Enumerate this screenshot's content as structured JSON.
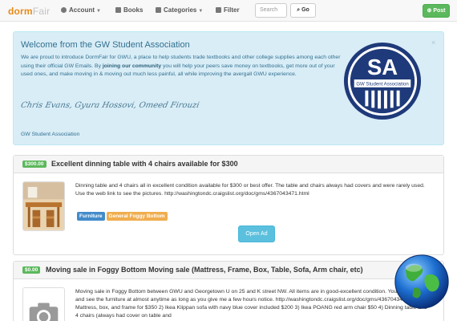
{
  "navbar": {
    "brand_main": "dorm",
    "brand_light": "Fair",
    "account_label": "Account",
    "books_label": "Books",
    "categories_label": "Categories",
    "filter_label": "Filter",
    "search_placeholder": "Search",
    "go_label": "Go",
    "post_label": "Post"
  },
  "welcome": {
    "title": "Welcome from the GW Student Association",
    "close": "×",
    "body_before": "We are proud to introduce DormFair for GWU, a place to help students trade textbooks and other college supplies among each other using their official GW Emails. By ",
    "body_bold": "joining our community",
    "body_after": " you will help your peers save money on textbooks, get more out of your used ones, and make moving in & moving out much less painful, all while improving the avergall GWU experience.",
    "signature": "Chris Evans, Gyura Hossovi, Omeed Firouzi",
    "org": "GW Student Association",
    "seal_letters": "SA",
    "seal_caption": "GW Student Association",
    "accent_color": "#31708f",
    "seal_color": "#1f3a7a"
  },
  "listings": [
    {
      "price": "$300.00",
      "title": "Excellent dinning table with 4 chairs available for $300",
      "description": "Dinning table and 4 chairs all in excellent condition available for $300 or best offer. The table and chairs always had covers and were rarely used. Use the web link to see the pictures. http://washingtondc.craigslist.org/doc/gms/4367043471.html",
      "tags": [
        "Furniture",
        "General Foggy Bottom"
      ],
      "action": "Open Ad"
    },
    {
      "price": "$0.00",
      "title": "Moving sale in Foggy Bottom Moving sale (Mattress, Frame, Box, Table, Sofa, Arm chair, etc)",
      "description": "Moving sale in Foggy Bottom between GWU and Georgetown U on 25 and K street NW. All items are in good-excellent condition. You can come and see the furniture at almost anytime as long as you give me a few hours notice. http://washingtondc.craigslist.org/doc/gms/4367043471.html 1) Mattress, box, and frame for $350 2) Ikea Klippan sofa with navy blue cover included $200 3) Ikea POANG red arm chair $50 4) Dinning table and 4 chairs (always had cover on table and"
    }
  ],
  "colors": {
    "primary_green": "#5cb85c",
    "brand_orange": "#e88b1a",
    "info_blue": "#5bc0de",
    "tag_blue": "#428bca",
    "tag_orange": "#f0ad4e"
  },
  "icons": [
    "user-icon",
    "book-icon",
    "list-icon",
    "filter-icon",
    "search-icon",
    "plus-circle-icon",
    "close-icon",
    "camera-icon",
    "globe-icon"
  ]
}
